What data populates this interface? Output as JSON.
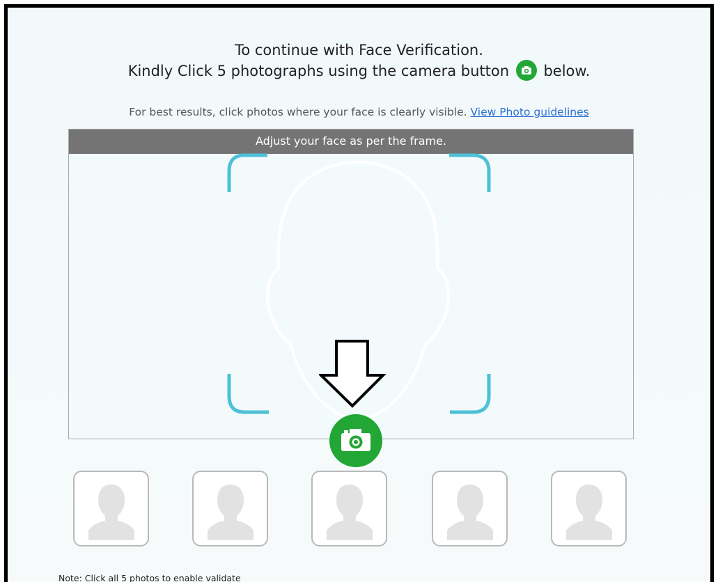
{
  "header": {
    "line1": "To continue with Face Verification.",
    "line2_before": "Kindly Click 5 photographs using the camera button",
    "line2_after": "below.",
    "inline_icon": "camera-icon"
  },
  "subtitle": {
    "text": "For best results, click photos where your face is clearly visible.",
    "link": "View Photo guidelines"
  },
  "frame": {
    "banner": "Adjust your face as per the frame.",
    "corner_color": "#4dc0d8",
    "face_outline_color": "#ffffff"
  },
  "capture_button": {
    "icon": "camera-icon",
    "color": "#22a635"
  },
  "pointer": {
    "icon": "arrow-down-icon"
  },
  "thumbnails": [
    {
      "icon": "user-silhouette-icon"
    },
    {
      "icon": "user-silhouette-icon"
    },
    {
      "icon": "user-silhouette-icon"
    },
    {
      "icon": "user-silhouette-icon"
    },
    {
      "icon": "user-silhouette-icon"
    }
  ],
  "note": "Note: Click all 5 photos to enable validate"
}
